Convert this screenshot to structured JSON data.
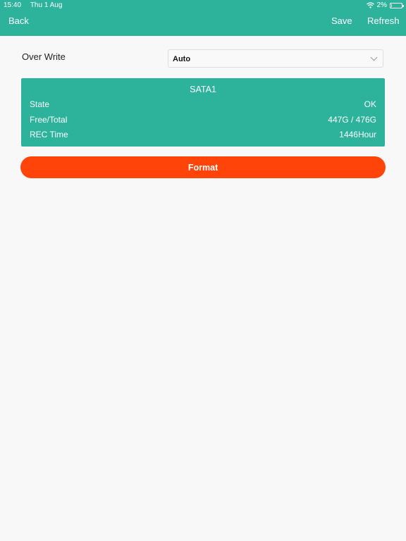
{
  "status_bar": {
    "time": "15:40",
    "date": "Thu 1 Aug",
    "battery": "2%",
    "battery_level": 0.02
  },
  "nav": {
    "back": "Back",
    "save": "Save",
    "refresh": "Refresh"
  },
  "overwrite": {
    "label": "Over Write",
    "value": "Auto"
  },
  "disk": {
    "title": "SATA1",
    "rows": [
      {
        "key": "State",
        "value": "OK"
      },
      {
        "key": "Free/Total",
        "value": "447G / 476G"
      },
      {
        "key": "REC Time",
        "value": "1446Hour"
      }
    ]
  },
  "format_button": "Format",
  "colors": {
    "accent": "#2db39c",
    "danger": "#ff4409"
  },
  "icons": [
    "wifi-icon",
    "battery-icon",
    "chevron-down-icon"
  ]
}
